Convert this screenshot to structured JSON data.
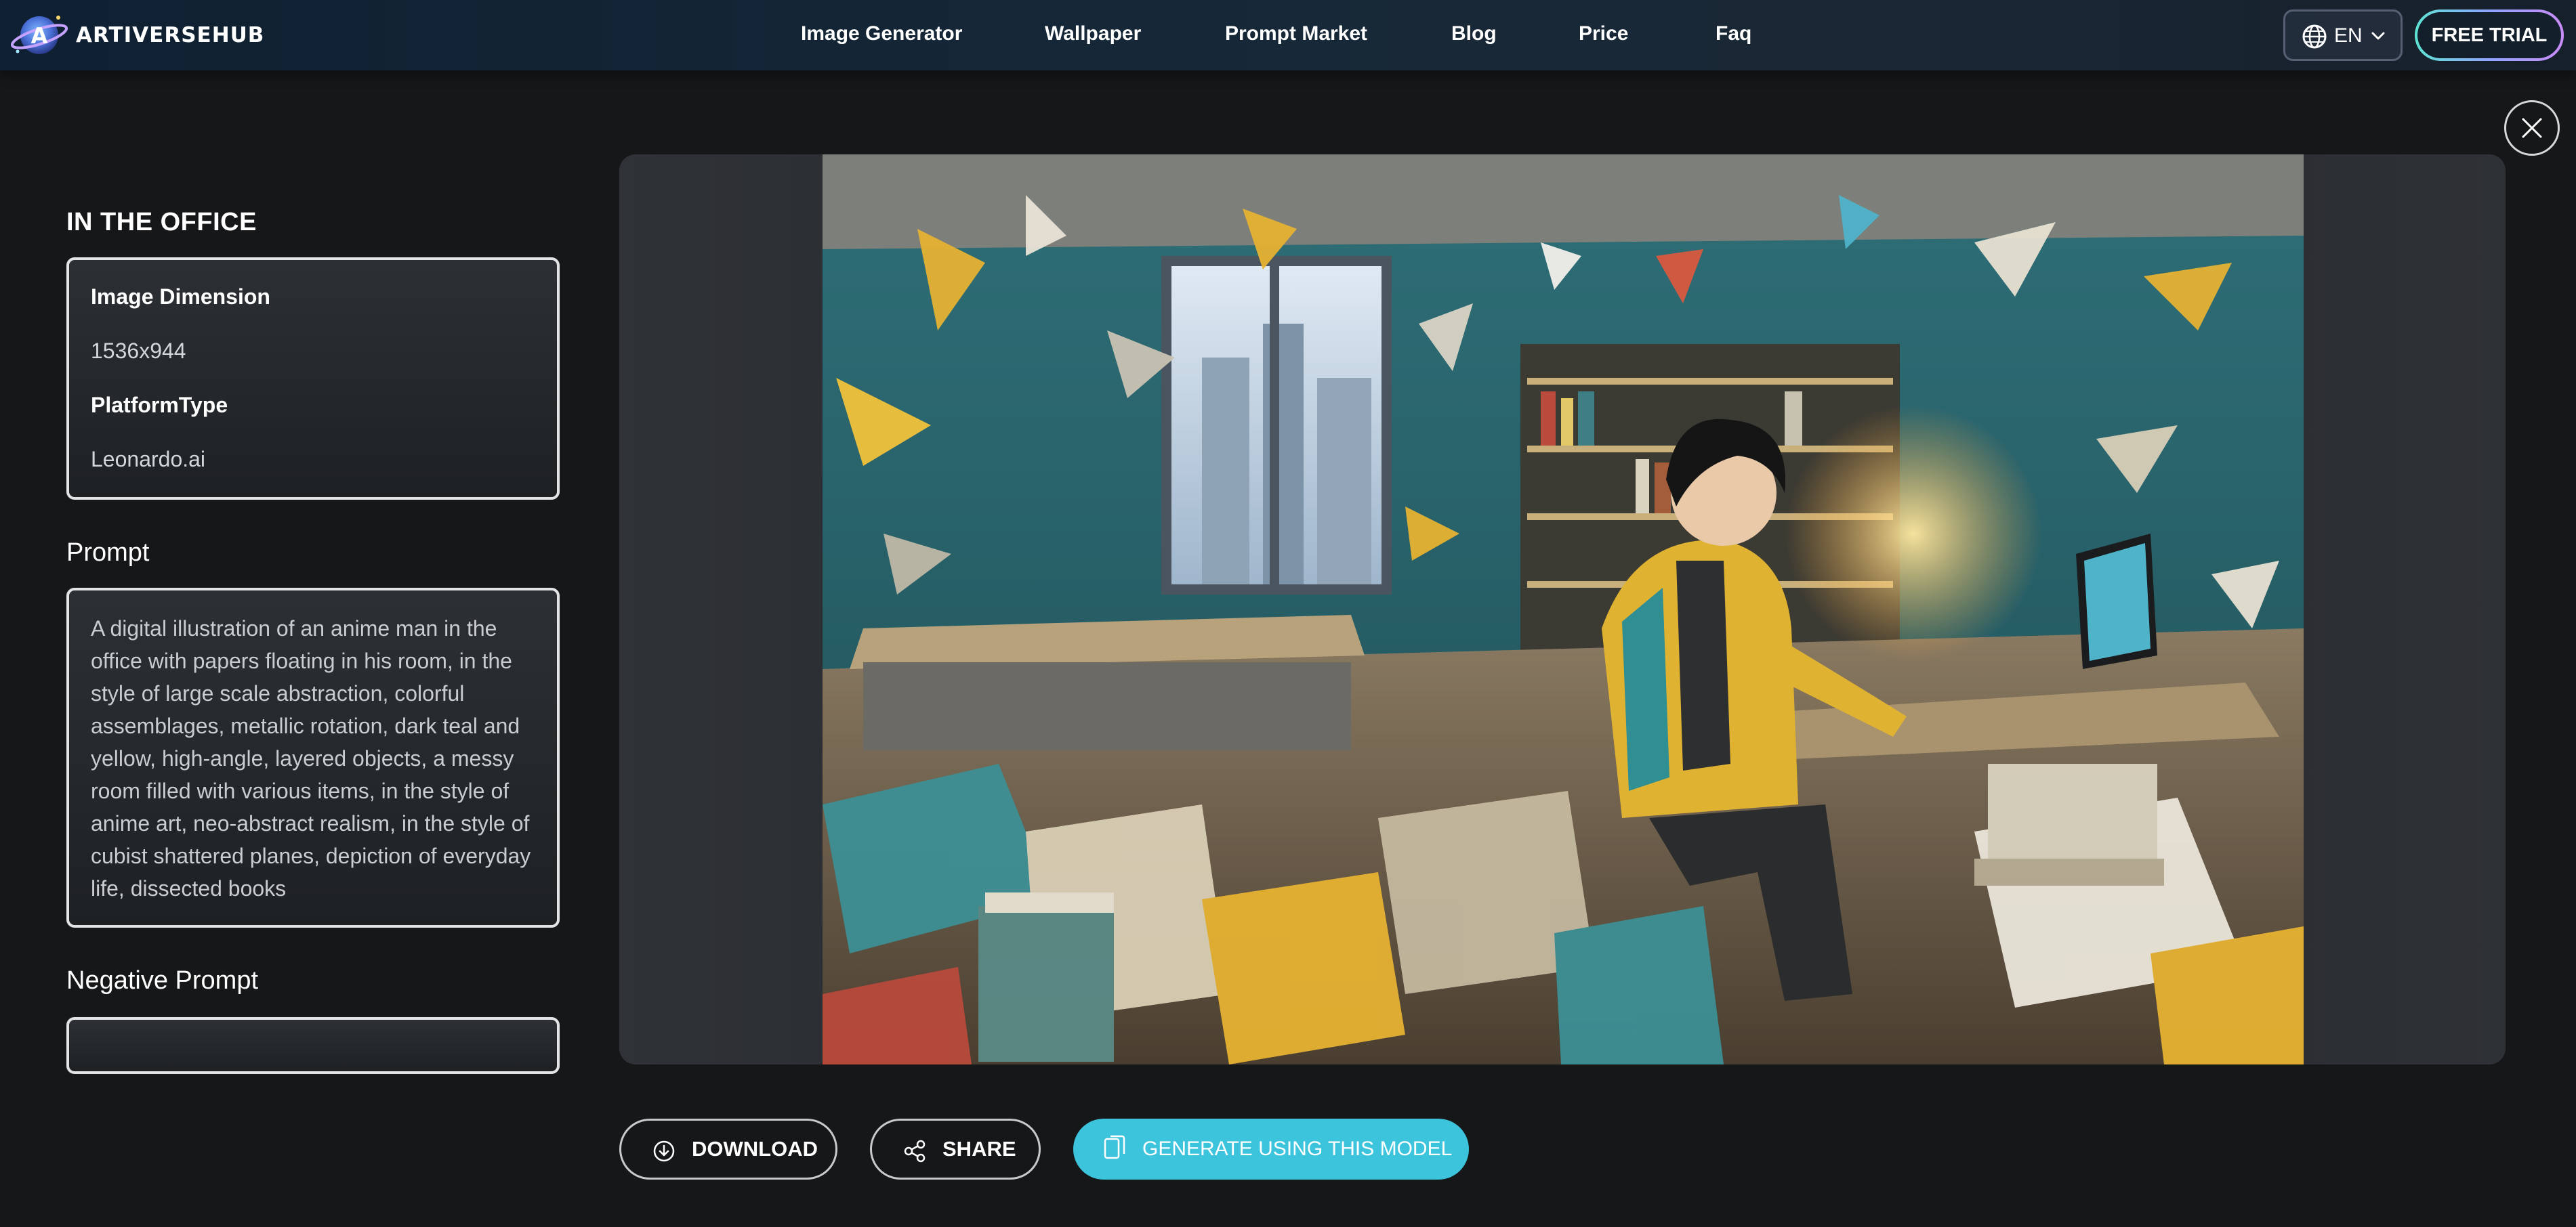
{
  "header": {
    "brand": "ARTIVERSEHUB",
    "nav": [
      {
        "label": "Image Generator"
      },
      {
        "label": "Wallpaper"
      },
      {
        "label": "Prompt Market"
      },
      {
        "label": "Blog"
      },
      {
        "label": "Price"
      },
      {
        "label": "Faq"
      }
    ],
    "language": "EN",
    "trial_label": "FREE TRIAL"
  },
  "detail": {
    "title": "IN THE OFFICE",
    "info": {
      "dimension_label": "Image Dimension",
      "dimension_value": "1536x944",
      "platform_label": "PlatformType",
      "platform_value": "Leonardo.ai"
    },
    "prompt_heading": "Prompt",
    "prompt_text": "A digital illustration of an anime man in the office with papers floating in his room, in the style of large scale abstraction, colorful assemblages, metallic rotation, dark teal and yellow, high-angle, layered objects, a messy room filled with various items, in the style of anime art, neo-abstract realism, in the style of cubist shattered planes, depiction of everyday life, dissected books",
    "negative_heading": "Negative Prompt",
    "negative_text": ""
  },
  "actions": {
    "download": "DOWNLOAD",
    "share": "SHARE",
    "generate": "GENERATE USING THIS MODEL"
  },
  "icons": {
    "logo": "planet-logo-icon",
    "language": "globe-icon",
    "dropdown": "chevron-down-icon",
    "close": "close-icon",
    "download": "download-icon",
    "share": "share-icon",
    "generate": "copy-icon"
  },
  "colors": {
    "background": "#161719",
    "accent": "#3cc4dc",
    "card_border": "#e3e4e6",
    "artwork_teal": "#3d8f95",
    "artwork_yellow": "#e6b232"
  }
}
